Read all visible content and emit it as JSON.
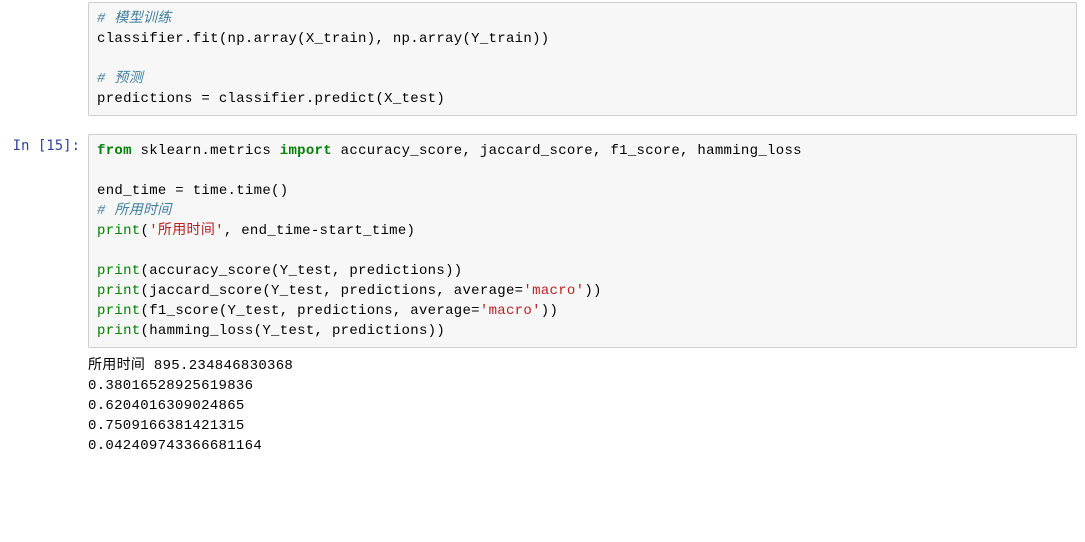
{
  "cells": [
    {
      "prompt": "",
      "code_html": "<span class=\"c\"># 模型训练</span>\nclassifier.fit(np.array(X_train), np.array(Y_train))\n\n<span class=\"c\"># 预测</span>\npredictions = classifier.predict(X_test)",
      "output": ""
    },
    {
      "prompt": "In  [15]:",
      "code_html": "<span class=\"k\">from</span> sklearn.metrics <span class=\"k\">import</span> accuracy_score, jaccard_score, f1_score, hamming_loss\n\nend_time = time.time()\n<span class=\"c\"># 所用时间</span>\n<span class=\"nb\">print</span>(<span class=\"s\">'所用时间'</span>, end_time-start_time)\n\n<span class=\"nb\">print</span>(accuracy_score(Y_test, predictions))\n<span class=\"nb\">print</span>(jaccard_score(Y_test, predictions, average=<span class=\"s\">'macro'</span>))\n<span class=\"nb\">print</span>(f1_score(Y_test, predictions, average=<span class=\"s\">'macro'</span>))\n<span class=\"nb\">print</span>(hamming_loss(Y_test, predictions))",
      "output": "所用时间 895.234846830368\n0.38016528925619836\n0.6204016309024865\n0.7509166381421315\n0.042409743366681164"
    }
  ]
}
